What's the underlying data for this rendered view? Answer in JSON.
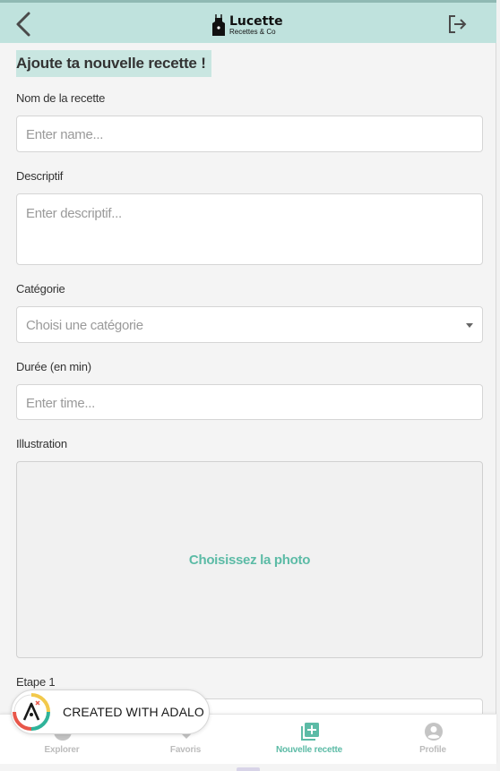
{
  "header": {
    "back_icon": "chevron-left-icon",
    "logo_name": "Lucette",
    "logo_subtitle": "Recettes & Co",
    "logout_icon": "logout-icon"
  },
  "form": {
    "title": "Ajoute ta nouvelle recette !",
    "name": {
      "label": "Nom de la recette",
      "placeholder": "Enter name..."
    },
    "description": {
      "label": "Descriptif",
      "placeholder": "Enter descriptif..."
    },
    "category": {
      "label": "Catégorie",
      "placeholder": "Choisi une catégorie"
    },
    "duration": {
      "label": "Durée (en min)",
      "placeholder": "Enter time..."
    },
    "illustration": {
      "label": "Illustration",
      "button": "Choisissez la photo"
    },
    "step1": {
      "label": "Etape 1"
    }
  },
  "tabbar": {
    "tabs": [
      {
        "label": "Explorer",
        "icon": "compass-icon",
        "active": false
      },
      {
        "label": "Favoris",
        "icon": "heart-icon",
        "active": false
      },
      {
        "label": "Nouvelle recette",
        "icon": "add-box-icon",
        "active": true
      },
      {
        "label": "Profile",
        "icon": "account-circle-icon",
        "active": false
      }
    ]
  },
  "badge": {
    "text": "CREATED WITH ADALO"
  },
  "colors": {
    "header_bg": "#bfe2dd",
    "accent": "#5cbba6",
    "inactive_tab": "#bcbcbc"
  }
}
